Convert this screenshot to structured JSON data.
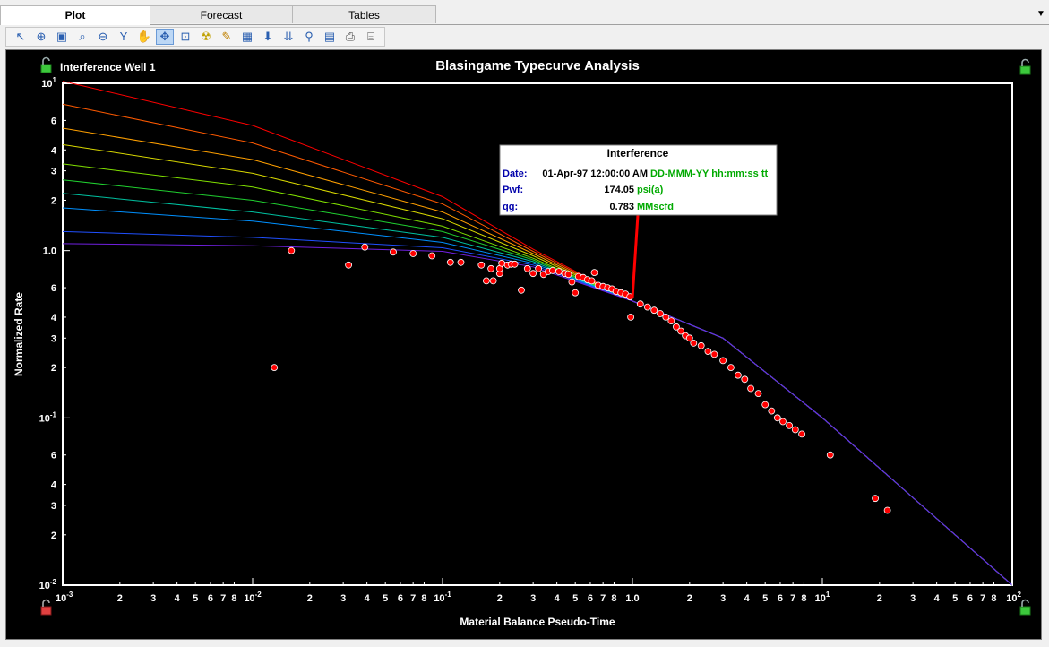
{
  "tabs": [
    {
      "label": "Plot",
      "active": true
    },
    {
      "label": "Forecast",
      "active": false
    },
    {
      "label": "Tables",
      "active": false
    }
  ],
  "toolbar": {
    "tools": [
      {
        "icon": "pointer-icon"
      },
      {
        "icon": "zoom-in-icon"
      },
      {
        "icon": "zoom-box-icon"
      },
      {
        "icon": "zoom-icon"
      },
      {
        "icon": "zoom-out-icon"
      },
      {
        "icon": "filter-funnel-icon"
      },
      {
        "icon": "hand-pan-icon"
      },
      {
        "icon": "move-icon",
        "selected": true
      },
      {
        "icon": "select-point-icon"
      },
      {
        "icon": "radiation-icon"
      },
      {
        "icon": "pencil-icon"
      },
      {
        "icon": "grid-table-icon"
      },
      {
        "icon": "arrow-down-icon"
      },
      {
        "icon": "double-arrow-down-icon"
      },
      {
        "icon": "filter-icon"
      },
      {
        "icon": "export-image-icon"
      },
      {
        "icon": "print-icon"
      },
      {
        "icon": "print-preview-icon"
      }
    ]
  },
  "plot": {
    "well_label": "Interference Well 1",
    "tooltip": {
      "title": "Interference",
      "rows": [
        {
          "label": "Date:",
          "value": "01-Apr-97 12:00:00 AM",
          "unit": "DD-MMM-YY hh:mm:ss tt"
        },
        {
          "label": "Pwf:",
          "value": "174.05",
          "unit": "psi(a)"
        },
        {
          "label": "qg:",
          "value": "0.783",
          "unit": "MMscfd"
        }
      ]
    }
  },
  "colors": {
    "background": "#000000",
    "frame": "#ffffff",
    "points": "#ff0000",
    "tooltip_label": "#0000aa",
    "tooltip_unit": "#00aa00",
    "curves": [
      "#ff0000",
      "#ff5a00",
      "#ffa000",
      "#d8d800",
      "#80e000",
      "#20d030",
      "#00c0a0",
      "#0090ff",
      "#2050ff",
      "#7020e0"
    ]
  },
  "chart_data": {
    "type": "scatter",
    "title": "Blasingame Typecurve Analysis",
    "xlabel": "Material Balance Pseudo-Time",
    "ylabel": "Normalized Rate",
    "x_scale": "log",
    "y_scale": "log",
    "xlim": [
      0.001,
      100
    ],
    "ylim": [
      0.01,
      10
    ],
    "x_ticks": [
      {
        "v": 0.001,
        "l": "10-3"
      },
      {
        "v": 0.002,
        "l": "2"
      },
      {
        "v": 0.003,
        "l": "3"
      },
      {
        "v": 0.004,
        "l": "4"
      },
      {
        "v": 0.005,
        "l": "5"
      },
      {
        "v": 0.006,
        "l": "6"
      },
      {
        "v": 0.007,
        "l": "7"
      },
      {
        "v": 0.008,
        "l": "8"
      },
      {
        "v": 0.01,
        "l": "10-2"
      },
      {
        "v": 0.02,
        "l": "2"
      },
      {
        "v": 0.03,
        "l": "3"
      },
      {
        "v": 0.04,
        "l": "4"
      },
      {
        "v": 0.05,
        "l": "5"
      },
      {
        "v": 0.06,
        "l": "6"
      },
      {
        "v": 0.07,
        "l": "7"
      },
      {
        "v": 0.08,
        "l": "8"
      },
      {
        "v": 0.1,
        "l": "10-1"
      },
      {
        "v": 0.2,
        "l": "2"
      },
      {
        "v": 0.3,
        "l": "3"
      },
      {
        "v": 0.4,
        "l": "4"
      },
      {
        "v": 0.5,
        "l": "5"
      },
      {
        "v": 0.6,
        "l": "6"
      },
      {
        "v": 0.7,
        "l": "7"
      },
      {
        "v": 0.8,
        "l": "8"
      },
      {
        "v": 1,
        "l": "1.0"
      },
      {
        "v": 2,
        "l": "2"
      },
      {
        "v": 3,
        "l": "3"
      },
      {
        "v": 4,
        "l": "4"
      },
      {
        "v": 5,
        "l": "5"
      },
      {
        "v": 6,
        "l": "6"
      },
      {
        "v": 7,
        "l": "7"
      },
      {
        "v": 8,
        "l": "8"
      },
      {
        "v": 10,
        "l": "101"
      },
      {
        "v": 20,
        "l": "2"
      },
      {
        "v": 30,
        "l": "3"
      },
      {
        "v": 40,
        "l": "4"
      },
      {
        "v": 50,
        "l": "5"
      },
      {
        "v": 60,
        "l": "6"
      },
      {
        "v": 70,
        "l": "7"
      },
      {
        "v": 80,
        "l": "8"
      },
      {
        "v": 100,
        "l": "102"
      }
    ],
    "y_ticks": [
      {
        "v": 10,
        "l": "101"
      },
      {
        "v": 6,
        "l": "6"
      },
      {
        "v": 4,
        "l": "4"
      },
      {
        "v": 3,
        "l": "3"
      },
      {
        "v": 2,
        "l": "2"
      },
      {
        "v": 1,
        "l": "1.0"
      },
      {
        "v": 0.6,
        "l": "6"
      },
      {
        "v": 0.4,
        "l": "4"
      },
      {
        "v": 0.3,
        "l": "3"
      },
      {
        "v": 0.2,
        "l": "2"
      },
      {
        "v": 0.1,
        "l": "10-1"
      },
      {
        "v": 0.06,
        "l": "6"
      },
      {
        "v": 0.04,
        "l": "4"
      },
      {
        "v": 0.03,
        "l": "3"
      },
      {
        "v": 0.02,
        "l": "2"
      },
      {
        "v": 0.01,
        "l": "10-2"
      }
    ],
    "typecurves": [
      {
        "values": [
          [
            0.001,
            10.3
          ],
          [
            0.01,
            5.6
          ],
          [
            0.1,
            2.1
          ],
          [
            0.3,
            1.02
          ],
          [
            1,
            0.5
          ],
          [
            3,
            0.3
          ],
          [
            10,
            0.1
          ],
          [
            100,
            0.01
          ]
        ]
      },
      {
        "values": [
          [
            0.001,
            7.5
          ],
          [
            0.01,
            4.4
          ],
          [
            0.1,
            1.9
          ],
          [
            0.3,
            0.99
          ],
          [
            1,
            0.5
          ],
          [
            3,
            0.3
          ],
          [
            10,
            0.1
          ],
          [
            100,
            0.01
          ]
        ]
      },
      {
        "values": [
          [
            0.001,
            5.4
          ],
          [
            0.01,
            3.5
          ],
          [
            0.1,
            1.7
          ],
          [
            0.3,
            0.96
          ],
          [
            1,
            0.5
          ],
          [
            3,
            0.3
          ],
          [
            10,
            0.1
          ],
          [
            100,
            0.01
          ]
        ]
      },
      {
        "values": [
          [
            0.001,
            4.3
          ],
          [
            0.01,
            2.9
          ],
          [
            0.1,
            1.55
          ],
          [
            0.3,
            0.93
          ],
          [
            1,
            0.5
          ],
          [
            3,
            0.3
          ],
          [
            10,
            0.1
          ],
          [
            100,
            0.01
          ]
        ]
      },
      {
        "values": [
          [
            0.001,
            3.3
          ],
          [
            0.01,
            2.4
          ],
          [
            0.1,
            1.4
          ],
          [
            0.3,
            0.9
          ],
          [
            1,
            0.5
          ],
          [
            3,
            0.3
          ],
          [
            10,
            0.1
          ],
          [
            100,
            0.01
          ]
        ]
      },
      {
        "values": [
          [
            0.001,
            2.65
          ],
          [
            0.01,
            2.0
          ],
          [
            0.1,
            1.3
          ],
          [
            0.3,
            0.88
          ],
          [
            1,
            0.5
          ],
          [
            3,
            0.3
          ],
          [
            10,
            0.1
          ],
          [
            100,
            0.01
          ]
        ]
      },
      {
        "values": [
          [
            0.001,
            2.2
          ],
          [
            0.01,
            1.7
          ],
          [
            0.1,
            1.2
          ],
          [
            0.3,
            0.86
          ],
          [
            1,
            0.5
          ],
          [
            3,
            0.3
          ],
          [
            10,
            0.1
          ],
          [
            100,
            0.01
          ]
        ]
      },
      {
        "values": [
          [
            0.001,
            1.8
          ],
          [
            0.01,
            1.5
          ],
          [
            0.1,
            1.12
          ],
          [
            0.3,
            0.84
          ],
          [
            1,
            0.5
          ],
          [
            3,
            0.3
          ],
          [
            10,
            0.1
          ],
          [
            100,
            0.01
          ]
        ]
      },
      {
        "values": [
          [
            0.001,
            1.3
          ],
          [
            0.01,
            1.2
          ],
          [
            0.1,
            1.04
          ],
          [
            0.3,
            0.82
          ],
          [
            1,
            0.5
          ],
          [
            3,
            0.3
          ],
          [
            10,
            0.1
          ],
          [
            100,
            0.01
          ]
        ]
      },
      {
        "values": [
          [
            0.001,
            1.1
          ],
          [
            0.01,
            1.07
          ],
          [
            0.1,
            0.99
          ],
          [
            0.3,
            0.8
          ],
          [
            1,
            0.5
          ],
          [
            3,
            0.3
          ],
          [
            10,
            0.1
          ],
          [
            100,
            0.01
          ]
        ]
      }
    ],
    "points": [
      [
        0.013,
        0.2
      ],
      [
        0.016,
        1.0
      ],
      [
        0.032,
        0.82
      ],
      [
        0.039,
        1.05
      ],
      [
        0.055,
        0.98
      ],
      [
        0.07,
        0.96
      ],
      [
        0.088,
        0.93
      ],
      [
        0.11,
        0.85
      ],
      [
        0.125,
        0.85
      ],
      [
        0.16,
        0.82
      ],
      [
        0.17,
        0.66
      ],
      [
        0.18,
        0.78
      ],
      [
        0.185,
        0.66
      ],
      [
        0.2,
        0.73
      ],
      [
        0.2,
        0.78
      ],
      [
        0.205,
        0.84
      ],
      [
        0.22,
        0.82
      ],
      [
        0.23,
        0.83
      ],
      [
        0.24,
        0.83
      ],
      [
        0.26,
        0.58
      ],
      [
        0.28,
        0.78
      ],
      [
        0.3,
        0.73
      ],
      [
        0.32,
        0.78
      ],
      [
        0.34,
        0.72
      ],
      [
        0.36,
        0.75
      ],
      [
        0.38,
        0.76
      ],
      [
        0.41,
        0.75
      ],
      [
        0.44,
        0.73
      ],
      [
        0.46,
        0.72
      ],
      [
        0.48,
        0.65
      ],
      [
        0.5,
        0.56
      ],
      [
        0.52,
        0.7
      ],
      [
        0.55,
        0.69
      ],
      [
        0.58,
        0.67
      ],
      [
        0.61,
        0.66
      ],
      [
        0.63,
        0.74
      ],
      [
        0.66,
        0.62
      ],
      [
        0.7,
        0.61
      ],
      [
        0.74,
        0.6
      ],
      [
        0.78,
        0.59
      ],
      [
        0.82,
        0.57
      ],
      [
        0.87,
        0.56
      ],
      [
        0.92,
        0.55
      ],
      [
        0.97,
        0.53
      ],
      [
        0.98,
        0.4
      ],
      [
        1.1,
        0.48
      ],
      [
        1.2,
        0.46
      ],
      [
        1.3,
        0.44
      ],
      [
        1.4,
        0.42
      ],
      [
        1.5,
        0.4
      ],
      [
        1.6,
        0.38
      ],
      [
        1.7,
        0.35
      ],
      [
        1.8,
        0.33
      ],
      [
        1.9,
        0.31
      ],
      [
        2.0,
        0.3
      ],
      [
        2.1,
        0.28
      ],
      [
        2.3,
        0.27
      ],
      [
        2.5,
        0.25
      ],
      [
        2.7,
        0.24
      ],
      [
        3.0,
        0.22
      ],
      [
        3.3,
        0.2
      ],
      [
        3.6,
        0.18
      ],
      [
        3.9,
        0.17
      ],
      [
        4.2,
        0.15
      ],
      [
        4.6,
        0.14
      ],
      [
        5.0,
        0.12
      ],
      [
        5.4,
        0.11
      ],
      [
        5.8,
        0.1
      ],
      [
        6.2,
        0.095
      ],
      [
        6.7,
        0.09
      ],
      [
        7.2,
        0.085
      ],
      [
        7.8,
        0.08
      ],
      [
        11,
        0.06
      ],
      [
        19,
        0.033
      ],
      [
        22,
        0.028
      ]
    ],
    "marker": {
      "x": 1.0,
      "y": 0.52
    }
  }
}
